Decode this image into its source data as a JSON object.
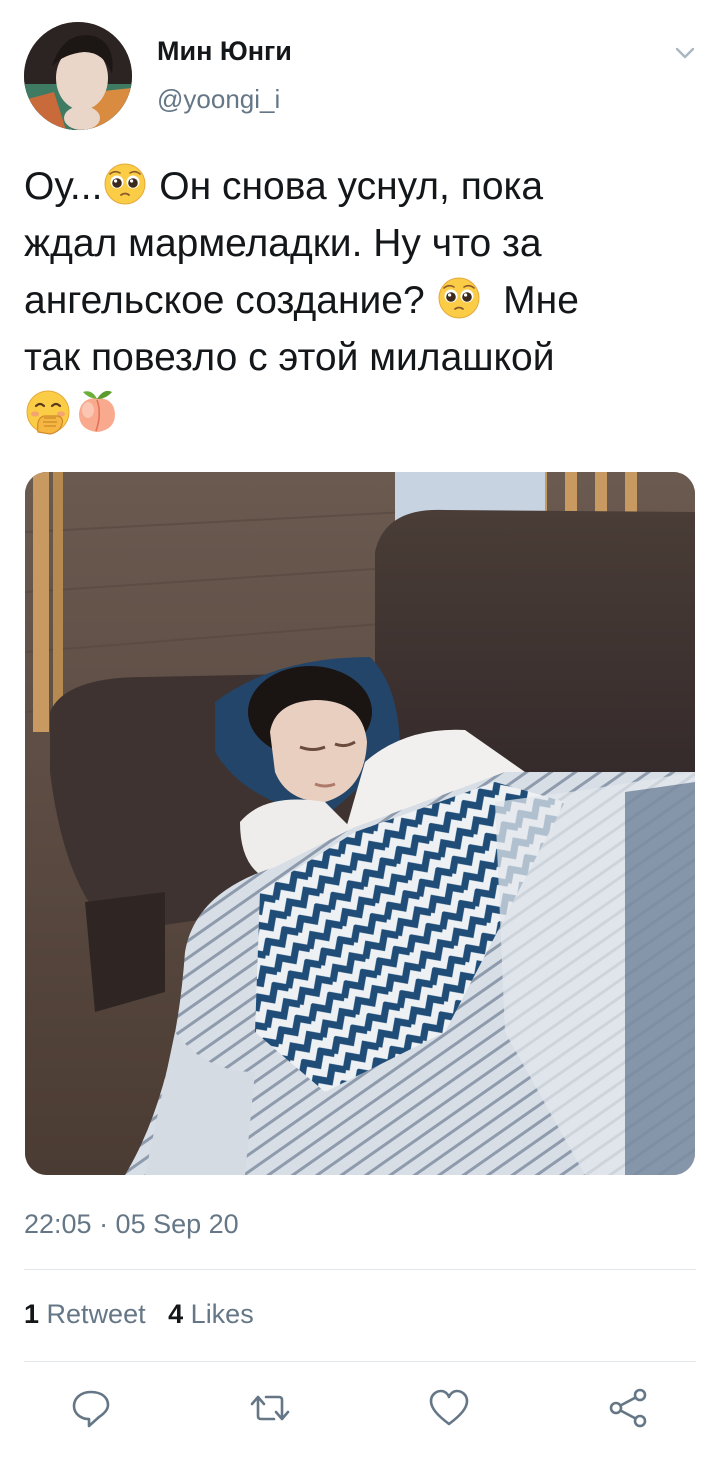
{
  "tweet": {
    "author": {
      "display_name": "Мин Юнги",
      "handle": "@yoongi_i",
      "avatar_icon": "profile-photo"
    },
    "menu_icon": "chevron-down-icon",
    "text_lines": [
      {
        "parts": [
          "Оу...",
          "Он снова уснул, пока"
        ],
        "emoji": [
          "pleading-face"
        ]
      },
      {
        "parts": [
          "ждал мармеладки. Ну что за"
        ]
      },
      {
        "parts": [
          "ангельское создание?",
          "Мне"
        ],
        "emoji": [
          "pleading-face"
        ]
      },
      {
        "parts": [
          "так повезло с этой милашкой"
        ]
      },
      {
        "parts": [],
        "emoji": [
          "hand-over-mouth",
          "peach"
        ]
      }
    ],
    "media": {
      "kind": "photo"
    },
    "timestamp": "22:05 · 05 Sep 20",
    "stats": {
      "retweets_count": "1",
      "retweets_label": "Retweet",
      "likes_count": "4",
      "likes_label": "Likes"
    },
    "actions": [
      {
        "name": "reply",
        "icon": "reply-icon"
      },
      {
        "name": "retweet",
        "icon": "retweet-icon"
      },
      {
        "name": "like",
        "icon": "heart-icon"
      },
      {
        "name": "share",
        "icon": "share-icon"
      }
    ]
  },
  "colors": {
    "text_primary": "#14171a",
    "text_secondary": "#657786",
    "divider": "#e1e8ed",
    "icon": "#657786"
  }
}
